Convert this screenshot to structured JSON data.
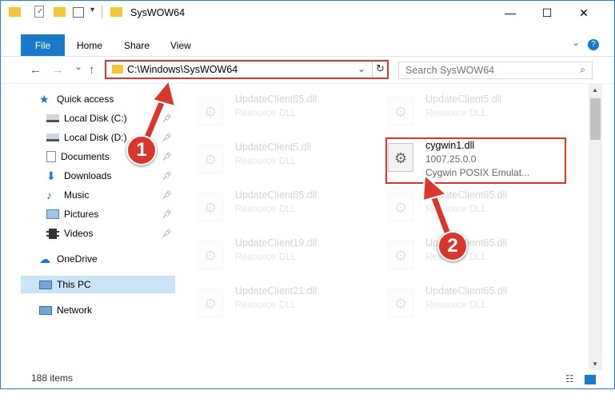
{
  "titlebar": {
    "title": "SysWOW64",
    "minimize": "—",
    "maximize": "☐",
    "close": "✕"
  },
  "ribbon": {
    "file": "File",
    "home": "Home",
    "share": "Share",
    "view": "View",
    "expand": "⌄",
    "help": "?"
  },
  "nav": {
    "back": "←",
    "forward": "→",
    "recent": "⌄",
    "up": "↑",
    "path": "C:\\Windows\\SysWOW64",
    "search_placeholder": "Search SysWOW64"
  },
  "sidebar": {
    "items": [
      {
        "label": "Quick access"
      },
      {
        "label": "Local Disk (C:)"
      },
      {
        "label": "Local Disk (D:)"
      },
      {
        "label": "Documents"
      },
      {
        "label": "Downloads"
      },
      {
        "label": "Music"
      },
      {
        "label": "Pictures"
      },
      {
        "label": "Videos"
      },
      {
        "label": "OneDrive"
      },
      {
        "label": "This PC"
      },
      {
        "label": "Network"
      }
    ]
  },
  "files": [
    {
      "name": "UpdateClient65.dll",
      "type": "Resource DLL"
    },
    {
      "name": "UpdateClient5.dll",
      "type": "Resource DLL"
    },
    {
      "name": "UpdateClient5.dll",
      "type": "Resource DLL"
    },
    {
      "name": "cygwin1.dll",
      "version": "1007.25.0.0",
      "desc": "Cygwin POSIX Emulat..."
    },
    {
      "name": "UpdateClient65.dll",
      "type": "Resource DLL"
    },
    {
      "name": "UpdateClient65.dll",
      "type": "Resource DLL"
    },
    {
      "name": "UpdateClient19.dll",
      "type": "Resource DLL"
    },
    {
      "name": "UpdateClient65.dll",
      "type": "Resource DLL"
    },
    {
      "name": "UpdateClient21.dll",
      "type": "Resource DLL"
    },
    {
      "name": "UpdateClient65.dll",
      "type": "Resource DLL"
    }
  ],
  "status": {
    "count": "188 items"
  },
  "annotations": {
    "step1": "1",
    "step2": "2",
    "color": "#d9372e"
  }
}
